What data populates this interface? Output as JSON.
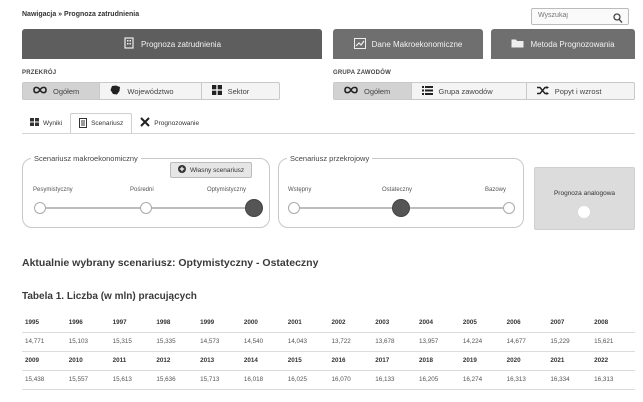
{
  "breadcrumb": "Nawigacja » Prognoza zatrudnienia",
  "search": {
    "placeholder": "Wyszukaj",
    "icon": "search-icon"
  },
  "main_tabs": [
    {
      "label": "Prognoza zatrudnienia",
      "icon": "building-icon",
      "active": true
    },
    {
      "label": "Dane Makroekonomiczne",
      "icon": "chart-icon",
      "active": false
    },
    {
      "label": "Metoda Prognozowania",
      "icon": "folder-icon",
      "active": false
    }
  ],
  "przekroj": {
    "label": "PRZEKRÓJ",
    "options": [
      {
        "label": "Ogółem",
        "icon": "infinity-icon",
        "selected": true
      },
      {
        "label": "Województwo",
        "icon": "map-icon",
        "selected": false
      },
      {
        "label": "Sektor",
        "icon": "grid-icon",
        "selected": false
      }
    ]
  },
  "grupa": {
    "label": "GRUPA ZAWODÓW",
    "options": [
      {
        "label": "Ogółem",
        "icon": "infinity-icon",
        "selected": true
      },
      {
        "label": "Grupa zawodów",
        "icon": "list-icon",
        "selected": false
      },
      {
        "label": "Popyt i wzrost",
        "icon": "shuffle-icon",
        "selected": false
      }
    ]
  },
  "subtabs": [
    {
      "label": "Wyniki",
      "icon": "table-icon",
      "selected": false
    },
    {
      "label": "Scenariusz",
      "icon": "document-icon",
      "selected": true
    },
    {
      "label": "Prognozowanie",
      "icon": "tools-icon",
      "selected": false
    }
  ],
  "macro": {
    "legend": "Scenariusz makroekonomiczny",
    "own_button": "Własny scenariusz",
    "stops": [
      "Pesymistyczny",
      "Pośredni",
      "Optymistyczny"
    ],
    "selected_index": 2
  },
  "cross": {
    "legend": "Scenariusz przekrojowy",
    "stops": [
      "Wstępny",
      "Ostateczny",
      "Bazowy"
    ],
    "selected_index": 1
  },
  "analog": {
    "label": "Prognoza analogowa"
  },
  "current_scenario": "Aktualnie wybrany scenariusz: Optymistyczny - Ostateczny",
  "table": {
    "title": "Tabela 1. Liczba (w mln) pracujących",
    "rows": [
      {
        "type": "year",
        "cells": [
          "1995",
          "1996",
          "1997",
          "1998",
          "1999",
          "2000",
          "2001",
          "2002",
          "2003",
          "2004",
          "2005",
          "2006",
          "2007",
          "2008"
        ]
      },
      {
        "type": "value",
        "cells": [
          "14,771",
          "15,103",
          "15,315",
          "15,335",
          "14,573",
          "14,540",
          "14,043",
          "13,722",
          "13,678",
          "13,957",
          "14,224",
          "14,677",
          "15,229",
          "15,621"
        ]
      },
      {
        "type": "year",
        "cells": [
          "2009",
          "2010",
          "2011",
          "2012",
          "2013",
          "2014",
          "2015",
          "2016",
          "2017",
          "2018",
          "2019",
          "2020",
          "2021",
          "2022"
        ]
      },
      {
        "type": "value",
        "cells": [
          "15,438",
          "15,557",
          "15,613",
          "15,636",
          "15,713",
          "16,018",
          "16,025",
          "16,070",
          "16,133",
          "16,205",
          "16,274",
          "16,313",
          "16,334",
          "16,313"
        ]
      }
    ]
  }
}
